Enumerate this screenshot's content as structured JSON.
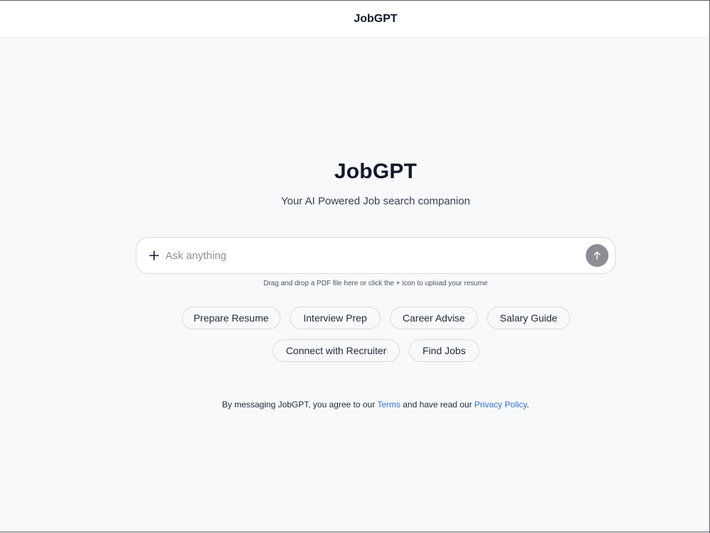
{
  "header": {
    "title": "JobGPT"
  },
  "hero": {
    "title": "JobGPT",
    "subtitle": "Your AI Powered Job search companion"
  },
  "chat": {
    "placeholder": "Ask anything",
    "value": "",
    "upload_icon": "plus-icon",
    "send_icon": "arrow-up-icon",
    "hint": "Drag and drop a PDF file here or click the + icon to upload your resume"
  },
  "suggestions": [
    "Prepare Resume",
    "Interview Prep",
    "Career Advise",
    "Salary Guide",
    "Connect with Recruiter",
    "Find Jobs"
  ],
  "legal": {
    "prefix": "By messaging JobGPT, you agree to our",
    "terms": "Terms",
    "middle": "and have read our",
    "privacy": "Privacy Policy",
    "suffix": "."
  },
  "colors": {
    "background": "#f8f9fb",
    "link": "#2f6fd0",
    "send_button": "#8c8e93"
  }
}
